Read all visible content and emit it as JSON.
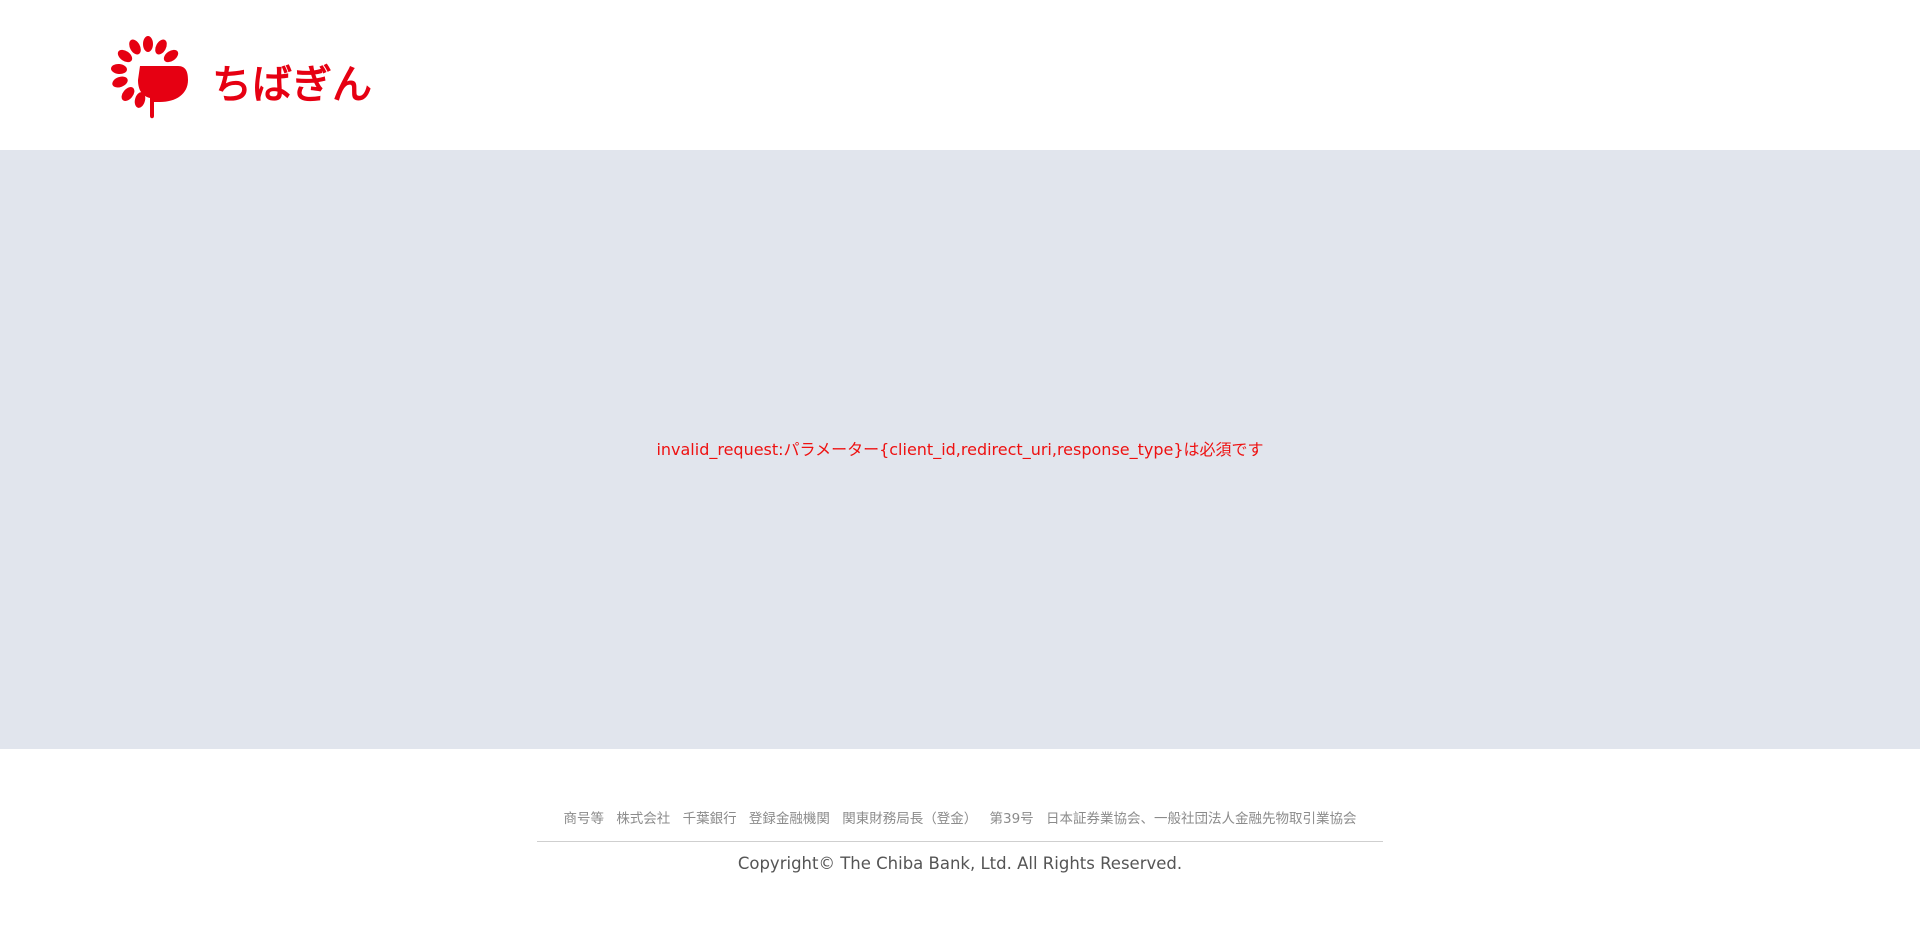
{
  "header": {
    "logo_text": "ちばぎん",
    "logo_color": "#e60012"
  },
  "main": {
    "error_message": "invalid_request:パラメーター{client_id,redirect_uri,response_type}は必須です",
    "error_color": "#ee1111",
    "background_color": "#e1e5ed"
  },
  "footer": {
    "registration": [
      "商号等",
      "株式会社",
      "千葉銀行",
      "登録金融機関",
      "関東財務局長（登金）",
      "第39号",
      "日本証券業協会、一般社団法人金融先物取引業協会"
    ],
    "copyright": "Copyright© The Chiba Bank, Ltd. All Rights Reserved."
  }
}
